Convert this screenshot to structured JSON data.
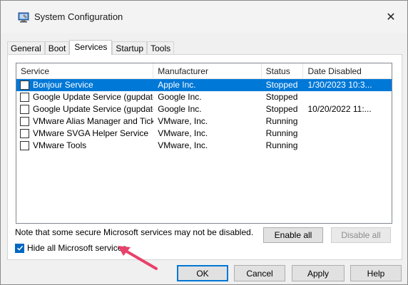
{
  "window": {
    "title": "System Configuration",
    "close_glyph": "✕"
  },
  "tabs": [
    {
      "label": "General"
    },
    {
      "label": "Boot"
    },
    {
      "label": "Services"
    },
    {
      "label": "Startup"
    },
    {
      "label": "Tools"
    }
  ],
  "active_tab": "Services",
  "services_table": {
    "columns": [
      "Service",
      "Manufacturer",
      "Status",
      "Date Disabled"
    ],
    "rows": [
      {
        "checked": false,
        "service": "Bonjour Service",
        "manufacturer": "Apple Inc.",
        "status": "Stopped",
        "date_disabled": "1/30/2023 10:3...",
        "selected": true
      },
      {
        "checked": false,
        "service": "Google Update Service (gupdate)",
        "manufacturer": "Google Inc.",
        "status": "Stopped",
        "date_disabled": "",
        "selected": false
      },
      {
        "checked": false,
        "service": "Google Update Service (gupdatem)",
        "manufacturer": "Google Inc.",
        "status": "Stopped",
        "date_disabled": "10/20/2022 11:...",
        "selected": false
      },
      {
        "checked": false,
        "service": "VMware Alias Manager and Ticke...",
        "manufacturer": "VMware, Inc.",
        "status": "Running",
        "date_disabled": "",
        "selected": false
      },
      {
        "checked": false,
        "service": "VMware SVGA Helper Service",
        "manufacturer": "VMware, Inc.",
        "status": "Running",
        "date_disabled": "",
        "selected": false
      },
      {
        "checked": false,
        "service": "VMware Tools",
        "manufacturer": "VMware, Inc.",
        "status": "Running",
        "date_disabled": "",
        "selected": false
      }
    ]
  },
  "note": "Note that some secure Microsoft services may not be disabled.",
  "enable_all_label": "Enable all",
  "disable_all_label": "Disable all",
  "hide_ms_services": {
    "label": "Hide all Microsoft services",
    "checked": true
  },
  "buttons": {
    "ok": "OK",
    "cancel": "Cancel",
    "apply": "Apply",
    "help": "Help"
  },
  "colors": {
    "selection": "#0078d7",
    "checkbox_checked": "#0067c0",
    "annotation_arrow": "#e8416a"
  },
  "icons": {
    "app": "system-configuration-icon",
    "close": "close-icon",
    "annotation": "arrow-icon"
  }
}
